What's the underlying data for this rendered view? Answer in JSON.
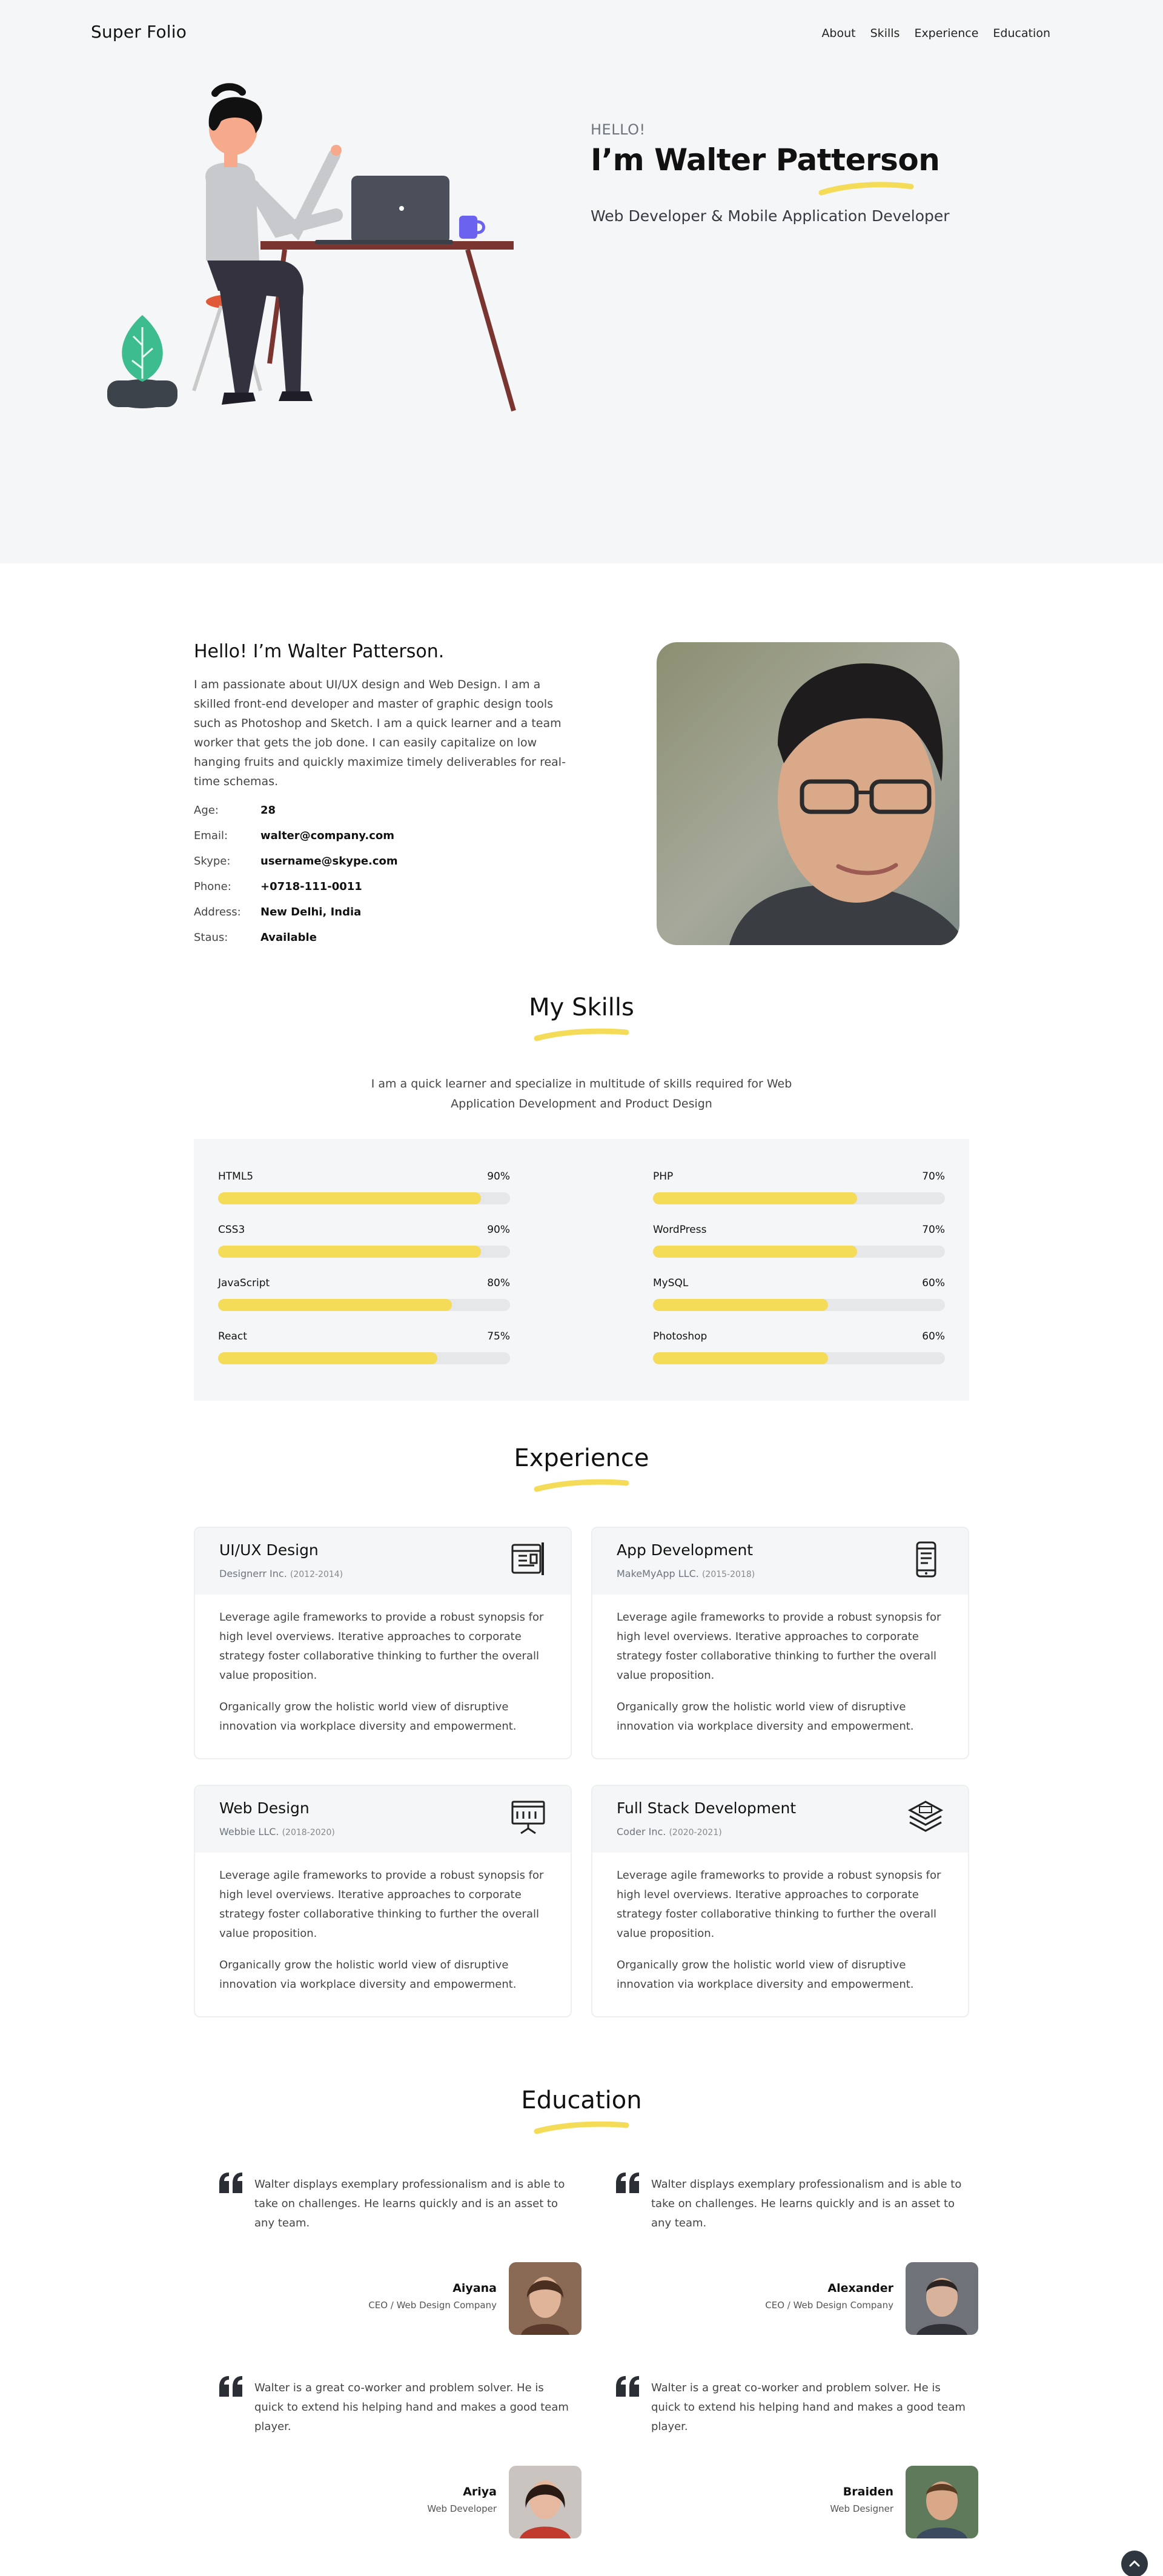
{
  "nav": {
    "brand": "Super Folio",
    "links": [
      "About",
      "Skills",
      "Experience",
      "Education"
    ]
  },
  "hero": {
    "hello": "HELLO!",
    "title": "I’m Walter Patterson",
    "subtitle": "Web Developer & Mobile Application Developer"
  },
  "about": {
    "title": "Hello! I’m Walter Patterson.",
    "text": "I am passionate about UI/UX design and Web Design. I am a skilled front-end developer and master of graphic design tools such as Photoshop and Sketch. I am a quick learner and a team worker that gets the job done. I can easily capitalize on low hanging fruits and quickly maximize timely deliverables for real-time schemas.",
    "info": [
      {
        "label": "Age:",
        "value": "28"
      },
      {
        "label": "Email:",
        "value": "walter@company.com"
      },
      {
        "label": "Skype:",
        "value": "username@skype.com"
      },
      {
        "label": "Phone:",
        "value": "+0718-111-0011"
      },
      {
        "label": "Address:",
        "value": "New Delhi, India"
      },
      {
        "label": "Staus:",
        "value": "Available"
      }
    ]
  },
  "skills": {
    "title": "My Skills",
    "lead": "I am a quick learner and specialize in multitude of skills required for Web Application Development and Product Design",
    "items": [
      {
        "name": "HTML5",
        "percent": "90%",
        "level": 90
      },
      {
        "name": "PHP",
        "percent": "70%",
        "level": 70
      },
      {
        "name": "CSS3",
        "percent": "90%",
        "level": 90
      },
      {
        "name": "WordPress",
        "percent": "70%",
        "level": 70
      },
      {
        "name": "JavaScript",
        "percent": "80%",
        "level": 80
      },
      {
        "name": "MySQL",
        "percent": "60%",
        "level": 60
      },
      {
        "name": "React",
        "percent": "75%",
        "level": 75
      },
      {
        "name": "Photoshop",
        "percent": "60%",
        "level": 60
      }
    ],
    "bar_color": "#f4dc58"
  },
  "experience": {
    "title": "Experience",
    "items": [
      {
        "role": "UI/UX Design",
        "company": "Designerr Inc.",
        "years": "(2012-2014)",
        "icon": "ui-design-icon",
        "p1": "Leverage agile frameworks to provide a robust synopsis for high level overviews. Iterative approaches to corporate strategy foster collaborative thinking to further the overall value proposition.",
        "p2": "Organically grow the holistic world view of disruptive innovation via workplace diversity and empowerment."
      },
      {
        "role": "App Development",
        "company": "MakeMyApp LLC.",
        "years": "(2015-2018)",
        "icon": "mobile-app-icon",
        "p1": "Leverage agile frameworks to provide a robust synopsis for high level overviews. Iterative approaches to corporate strategy foster collaborative thinking to further the overall value proposition.",
        "p2": "Organically grow the holistic world view of disruptive innovation via workplace diversity and empowerment."
      },
      {
        "role": "Web Design",
        "company": "Webbie LLC.",
        "years": "(2018-2020)",
        "icon": "web-design-icon",
        "p1": "Leverage agile frameworks to provide a robust synopsis for high level overviews. Iterative approaches to corporate strategy foster collaborative thinking to further the overall value proposition.",
        "p2": "Organically grow the holistic world view of disruptive innovation via workplace diversity and empowerment."
      },
      {
        "role": "Full Stack Development",
        "company": "Coder Inc.",
        "years": "(2020-2021)",
        "icon": "stack-layers-icon",
        "p1": "Leverage agile frameworks to provide a robust synopsis for high level overviews. Iterative approaches to corporate strategy foster collaborative thinking to further the overall value proposition.",
        "p2": "Organically grow the holistic world view of disruptive innovation via workplace diversity and empowerment."
      }
    ]
  },
  "education": {
    "title": "Education",
    "items": [
      {
        "text": "Walter displays exemplary professionalism and is able to take on challenges. He learns quickly and is an asset to any team.",
        "name": "Aiyana",
        "role": "CEO / Web Design Company"
      },
      {
        "text": "Walter displays exemplary professionalism and is able to take on challenges. He learns quickly and is an asset to any team.",
        "name": "Alexander",
        "role": "CEO / Web Design Company"
      },
      {
        "text": "Walter is a great co-worker and problem solver. He is quick to extend his helping hand and makes a good team player.",
        "name": "Ariya",
        "role": "Web Developer"
      },
      {
        "text": "Walter is a great co-worker and problem solver. He is quick to extend his helping hand and makes a good team player.",
        "name": "Braiden",
        "role": "Web Designer"
      }
    ]
  },
  "colors": {
    "accent": "#f4dc58",
    "hero_bg": "#f5f6f7",
    "dark": "#2f3640"
  }
}
